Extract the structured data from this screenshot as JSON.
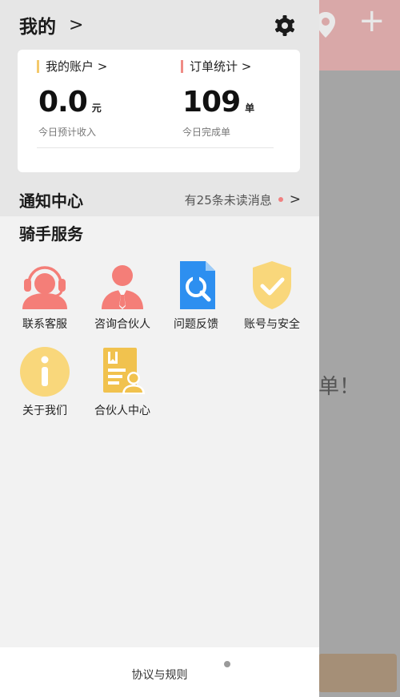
{
  "header": {
    "title": "我的",
    "chevron": ">"
  },
  "account_card": {
    "account": {
      "label": "我的账户 >",
      "value": "0.0",
      "unit": "元",
      "sub": "今日预计收入",
      "accent": "#f3c96b"
    },
    "orders": {
      "label": "订单统计 >",
      "value": "109",
      "unit": "单",
      "sub": "今日完成单",
      "accent": "#f08b85"
    }
  },
  "notice": {
    "title": "通知中心",
    "message": "有25条未读消息",
    "chevron": ">"
  },
  "services": {
    "title": "骑手服务",
    "items": [
      {
        "label": "联系客服",
        "icon": "headset-person-icon"
      },
      {
        "label": "咨询合伙人",
        "icon": "person-tie-icon"
      },
      {
        "label": "问题反馈",
        "icon": "wrench-document-icon"
      },
      {
        "label": "账号与安全",
        "icon": "shield-check-icon"
      },
      {
        "label": "关于我们",
        "icon": "info-icon"
      },
      {
        "label": "合伙人中心",
        "icon": "id-card-icon"
      }
    ]
  },
  "footer": {
    "label": "协议与规则"
  },
  "background": {
    "text": "单！"
  },
  "colors": {
    "coral": "#f47e78",
    "blue": "#2d8ff0",
    "yellow": "#f9d77b",
    "gold": "#f1c24e"
  }
}
